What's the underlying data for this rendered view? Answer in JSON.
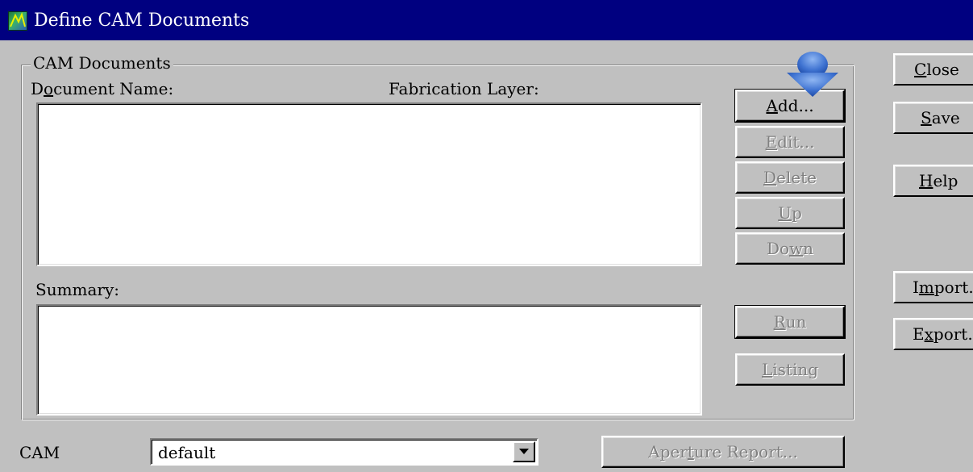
{
  "window": {
    "title": "Define CAM Documents",
    "icon": "cam-app-icon"
  },
  "group": {
    "legend": "CAM Documents"
  },
  "labels": {
    "document_name": "Document Name:",
    "fabrication_layer": "Fabrication Layer:",
    "summary": "Summary:",
    "cam": "CAM"
  },
  "buttons": {
    "add": {
      "label": "Add...",
      "mnemonic": "A",
      "enabled": true
    },
    "edit": {
      "label": "Edit...",
      "mnemonic": "E",
      "enabled": false
    },
    "delete": {
      "label": "Delete",
      "mnemonic": "D",
      "enabled": false
    },
    "up": {
      "label": "Up",
      "mnemonic": "U",
      "enabled": false
    },
    "down": {
      "label": "Down",
      "mnemonic": "w",
      "enabled": false
    },
    "run": {
      "label": "Run",
      "mnemonic": "R",
      "enabled": false
    },
    "listing": {
      "label": "Listing",
      "mnemonic": "L",
      "enabled": false
    },
    "aperture_report": {
      "label": "Aperture Report...",
      "mnemonic": "t",
      "enabled": false
    },
    "close": {
      "label": "Close",
      "mnemonic": "C",
      "enabled": true
    },
    "save": {
      "label": "Save",
      "mnemonic": "S",
      "enabled": true
    },
    "help": {
      "label": "Help",
      "mnemonic": "H",
      "enabled": true
    },
    "import": {
      "label": "Import...",
      "mnemonic": "m",
      "enabled": true
    },
    "export": {
      "label": "Export...",
      "mnemonic": "x",
      "enabled": true
    }
  },
  "cam_combo": {
    "value": "default"
  },
  "lists": {
    "documents": [],
    "summary": []
  },
  "colors": {
    "titlebar": "#000080",
    "face": "#c0c0c0",
    "pointer_arrow": "#4a7fd6"
  },
  "overlay": {
    "pointer": "down-arrow-indicator"
  }
}
